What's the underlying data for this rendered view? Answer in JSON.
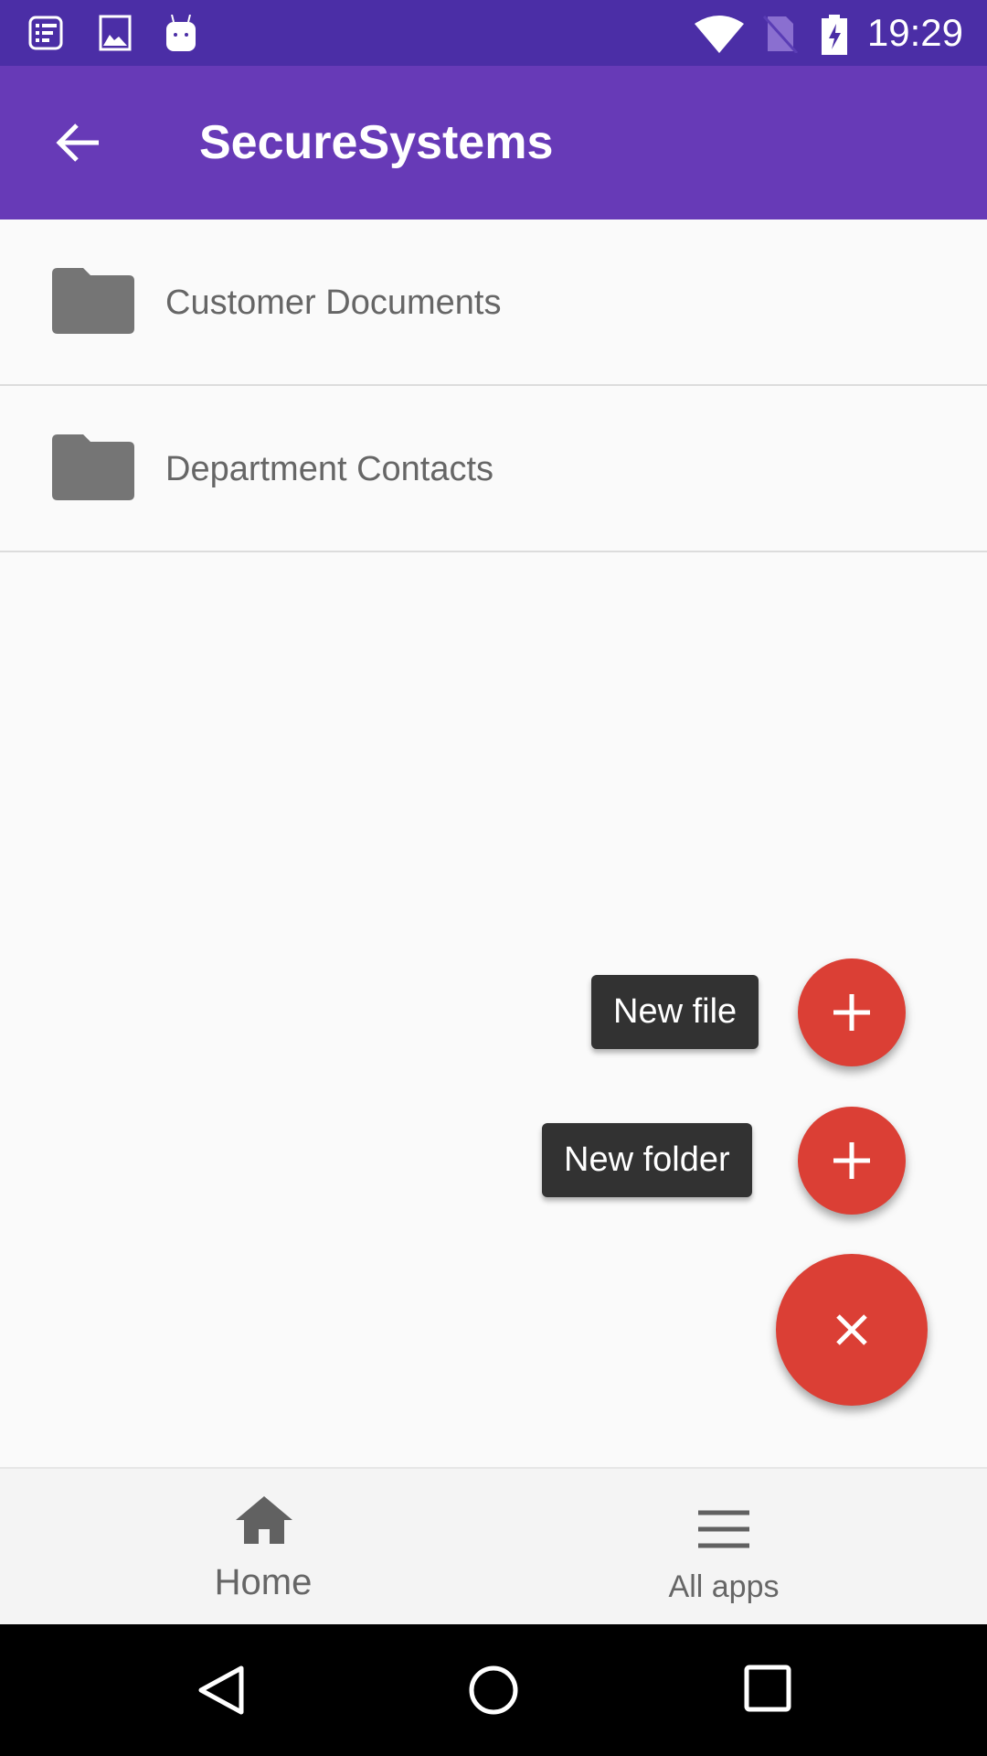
{
  "status_bar": {
    "time": "19:29",
    "left_icons": [
      "notes-icon",
      "image-icon",
      "android-icon"
    ],
    "right_icons": [
      "wifi-icon",
      "no-sim-icon",
      "battery-charging-icon"
    ]
  },
  "app_bar": {
    "title": "SecureSystems",
    "back_icon": "arrow-back-icon",
    "color": "#673ab7"
  },
  "folders": [
    {
      "label": "Customer Documents",
      "icon": "folder-icon"
    },
    {
      "label": "Department Contacts",
      "icon": "folder-icon"
    }
  ],
  "fab_menu": {
    "actions": [
      {
        "label": "New file",
        "icon": "plus-icon"
      },
      {
        "label": "New folder",
        "icon": "plus-icon"
      }
    ],
    "main_icon": "close-icon",
    "color": "#db3f35"
  },
  "bottom_nav": [
    {
      "label": "Home",
      "icon": "home-icon"
    },
    {
      "label": "All apps",
      "icon": "menu-icon"
    }
  ]
}
